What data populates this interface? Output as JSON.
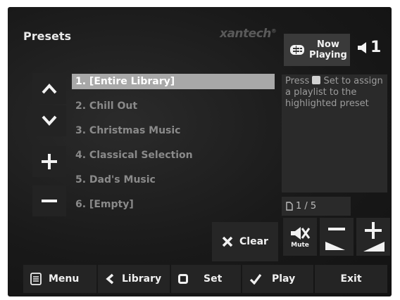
{
  "header": {
    "title": "Presets",
    "brand": "xantech",
    "brand_mark": "®",
    "now_playing_line1": "Now",
    "now_playing_line2": "Playing",
    "zone_number": "1"
  },
  "presets": [
    {
      "label": "1. [Entire Library]",
      "selected": true
    },
    {
      "label": "2. Chill Out",
      "selected": false
    },
    {
      "label": "3. Christmas Music",
      "selected": false
    },
    {
      "label": "4. Classical Selection",
      "selected": false
    },
    {
      "label": "5. Dad's Music",
      "selected": false
    },
    {
      "label": "6. [Empty]",
      "selected": false
    }
  ],
  "hint": {
    "press": "Press",
    "rest": "Set to assign a playlist to the highlighted preset"
  },
  "page_indicator": "1 / 5",
  "controls": {
    "clear_label": "Clear",
    "mute_label": "Mute"
  },
  "bottom_bar": {
    "menu": "Menu",
    "library": "Library",
    "set": "Set",
    "play": "Play",
    "exit": "Exit"
  },
  "colors": {
    "background": "#1b1b1b",
    "selected_row": "#a8a8a8",
    "text_primary": "#f0f0f0",
    "text_dim": "#8a8a8a"
  }
}
